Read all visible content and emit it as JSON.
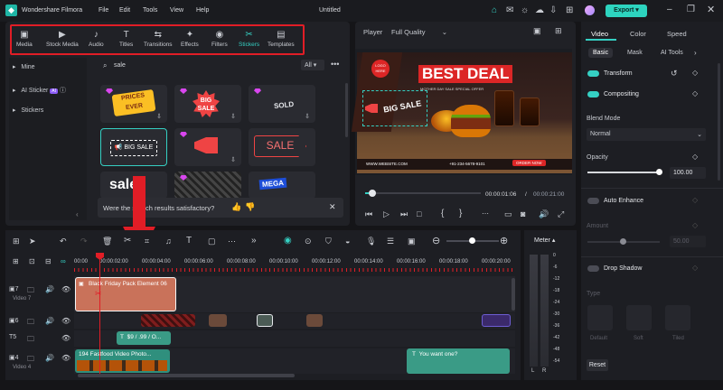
{
  "titlebar": {
    "app_name": "Wondershare Filmora",
    "menu": [
      "File",
      "Edit",
      "Tools",
      "View",
      "Help"
    ],
    "doc_title": "Untitled",
    "export_label": "Export"
  },
  "toolbar": [
    {
      "label": "Media",
      "icon": "media-icon"
    },
    {
      "label": "Stock Media",
      "icon": "stock-media-icon"
    },
    {
      "label": "Audio",
      "icon": "audio-icon"
    },
    {
      "label": "Titles",
      "icon": "titles-icon"
    },
    {
      "label": "Transitions",
      "icon": "transitions-icon"
    },
    {
      "label": "Effects",
      "icon": "effects-icon"
    },
    {
      "label": "Filters",
      "icon": "filters-icon"
    },
    {
      "label": "Stickers",
      "icon": "stickers-icon",
      "active": true
    },
    {
      "label": "Templates",
      "icon": "templates-icon"
    }
  ],
  "sidebar": {
    "items": [
      {
        "label": "Mine"
      },
      {
        "label": "AI Sticker",
        "badge": "AI"
      },
      {
        "label": "Stickers"
      }
    ]
  },
  "search": {
    "value": "sale",
    "filter": "All"
  },
  "stickers": [
    {
      "label": "PRICES EVER",
      "color": "#f59e0b"
    },
    {
      "label": "BIG SALE",
      "color": "#ef4444"
    },
    {
      "label": "SOLD OUT",
      "color": "#e5e7eb"
    },
    {
      "label": "BIG SALE",
      "color": "#ffffff"
    },
    {
      "label": "megaphone",
      "color": "#ef4444"
    },
    {
      "label": "SALE",
      "color": "#ef4444"
    },
    {
      "label": "sale",
      "color": "#ffffff"
    },
    {
      "label": "grunge",
      "color": "#9ca3af"
    },
    {
      "label": "MEGA SAVINGS",
      "color": "#2563eb"
    }
  ],
  "feedback": {
    "text": "Were the search results satisfactory?"
  },
  "player": {
    "label": "Player",
    "quality": "Full Quality",
    "current_time": "00:00:01:06",
    "total_time": "00:00:21:00",
    "progress": 0.06,
    "canvas": {
      "headline": "BEST DEAL",
      "logo": "LOGO HERE",
      "sticker": "BIG SALE",
      "website": "WWW.WEBSITE.COM",
      "phone": "+91-234-5678-9101",
      "cta": "ORDER NOW",
      "subtitle": "MOTHER DAY SALE SPECIAL OFFER"
    }
  },
  "properties": {
    "top_tabs": [
      "Video",
      "Color",
      "Speed"
    ],
    "active_top_tab": "Video",
    "sub_tabs": [
      "Basic",
      "Mask",
      "AI Tools"
    ],
    "active_sub_tab": "Basic",
    "transform": "Transform",
    "compositing": "Compositing",
    "blend_mode_label": "Blend Mode",
    "blend_mode": "Normal",
    "opacity_label": "Opacity",
    "opacity_value": "100.00",
    "opacity_level": 1.0,
    "auto_enhance": "Auto Enhance",
    "amount_label": "Amount",
    "amount_value": "50.00",
    "amount_level": 0.5,
    "drop_shadow": "Drop Shadow",
    "type_label": "Type",
    "shadow_types": [
      "Default",
      "Soft",
      "Tiled"
    ],
    "reset_label": "Reset"
  },
  "timeline": {
    "ruler": [
      "00:00",
      "00:00:02:00",
      "00:00:04:00",
      "00:00:06:00",
      "00:00:08:00",
      "00:00:10:00",
      "00:00:12:00",
      "00:00:14:00",
      "00:00:16:00",
      "00:00:18:00",
      "00:00:20:00"
    ],
    "tracks": [
      {
        "label": "Video 7",
        "index": "7"
      },
      {
        "label": "",
        "index": "6"
      },
      {
        "label": "",
        "index": "5"
      },
      {
        "label": "Video 4",
        "index": "4"
      }
    ],
    "clip_v7": "Black Friday Pack Element 06",
    "clip_title1": "$9 / .99 / O...",
    "clip_v4": "194 Fastfood Video Photo...",
    "clip_title2": "You want one?"
  },
  "meter": {
    "label": "Meter",
    "scale": [
      "0",
      "-6",
      "-12",
      "-18",
      "-24",
      "-30",
      "-36",
      "-42",
      "-48",
      "-54"
    ],
    "lr": [
      "L",
      "R"
    ]
  },
  "colors": {
    "accent": "#2dd4bf",
    "highlight": "#e11d26",
    "canvas_red": "#dc2626"
  }
}
